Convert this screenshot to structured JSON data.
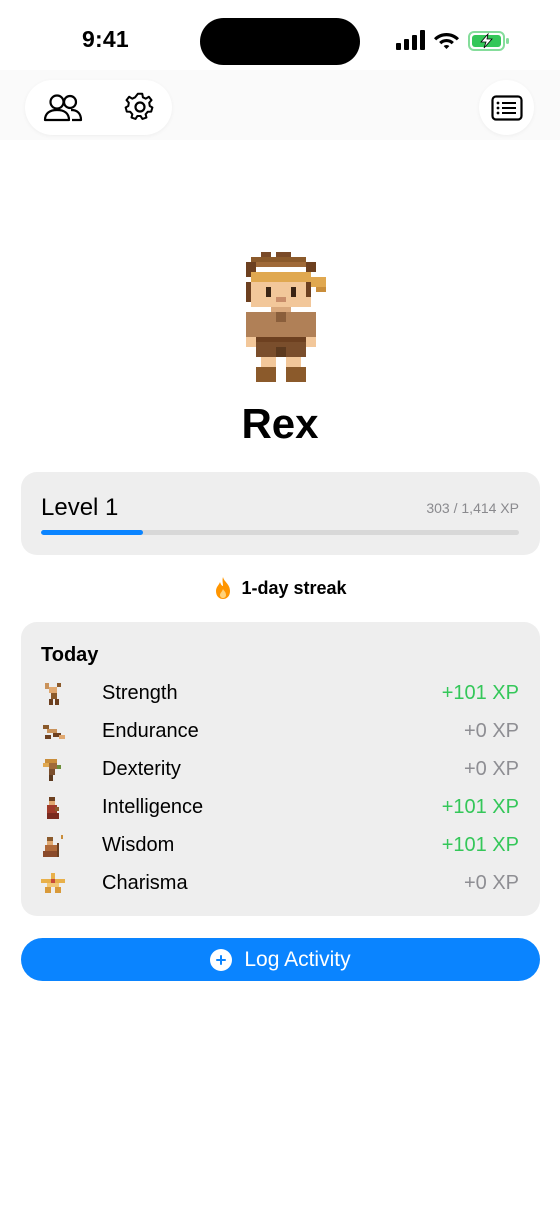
{
  "status_bar": {
    "time": "9:41"
  },
  "header": {
    "friends_icon": "people-icon",
    "settings_icon": "gear-icon",
    "log_icon": "list-icon"
  },
  "character": {
    "name": "Rex",
    "avatar_icon": "pixel-adventurer"
  },
  "level": {
    "label": "Level 1",
    "xp_text": "303 / 1,414 XP",
    "progress": 0.214,
    "progress_color": "#0a84ff"
  },
  "streak": {
    "icon": "flame-icon",
    "text": "1-day streak"
  },
  "today": {
    "title": "Today",
    "stats": [
      {
        "name": "Strength",
        "xp": "+101 XP",
        "gained": true,
        "icon": "strength-icon"
      },
      {
        "name": "Endurance",
        "xp": "+0 XP",
        "gained": false,
        "icon": "endurance-icon"
      },
      {
        "name": "Dexterity",
        "xp": "+0 XP",
        "gained": false,
        "icon": "dexterity-icon"
      },
      {
        "name": "Intelligence",
        "xp": "+101 XP",
        "gained": true,
        "icon": "intelligence-icon"
      },
      {
        "name": "Wisdom",
        "xp": "+101 XP",
        "gained": true,
        "icon": "wisdom-icon"
      },
      {
        "name": "Charisma",
        "xp": "+0 XP",
        "gained": false,
        "icon": "charisma-icon"
      }
    ],
    "gained_color": "#34c759",
    "neutral_color": "#8e8e93"
  },
  "actions": {
    "log_activity_label": "Log Activity"
  }
}
